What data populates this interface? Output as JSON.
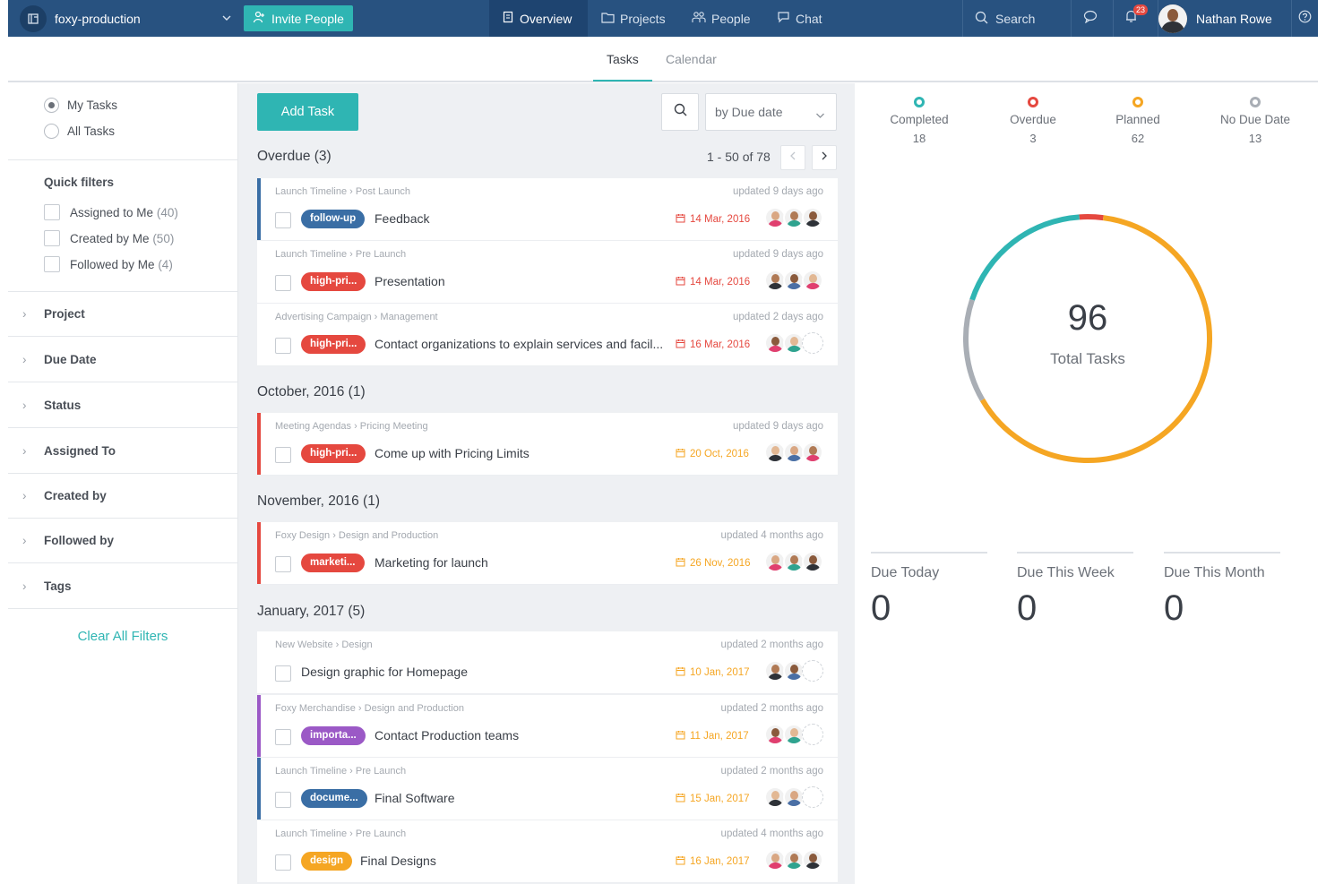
{
  "topbar": {
    "workspace": "foxy-production",
    "invite_label": "Invite People",
    "nav": [
      {
        "label": "Overview",
        "active": true
      },
      {
        "label": "Projects",
        "active": false
      },
      {
        "label": "People",
        "active": false
      },
      {
        "label": "Chat",
        "active": false
      }
    ],
    "search_label": "Search",
    "notification_count": "23",
    "user_name": "Nathan Rowe"
  },
  "subtabs": [
    {
      "label": "Tasks",
      "active": true
    },
    {
      "label": "Calendar",
      "active": false
    }
  ],
  "sidebar": {
    "scope": [
      {
        "label": "My Tasks",
        "selected": true
      },
      {
        "label": "All Tasks",
        "selected": false
      }
    ],
    "quick_filters_title": "Quick filters",
    "quick_filters": [
      {
        "label": "Assigned to Me",
        "count": "(40)"
      },
      {
        "label": "Created by Me",
        "count": "(50)"
      },
      {
        "label": "Followed by Me",
        "count": "(4)"
      }
    ],
    "filters": [
      "Project",
      "Due Date",
      "Status",
      "Assigned To",
      "Created by",
      "Followed by",
      "Tags"
    ],
    "clear_label": "Clear All Filters"
  },
  "tasks": {
    "add_label": "Add Task",
    "sort_label": "by Due date",
    "pager": "1 - 50 of 78",
    "groups": [
      {
        "title": "Overdue (3)"
      },
      {
        "title": "October, 2016 (1)"
      },
      {
        "title": "November, 2016 (1)"
      },
      {
        "title": "January, 2017 (5)"
      }
    ],
    "items": [
      {
        "project": "Launch Timeline",
        "list": "Post Launch",
        "updated": "updated 9 days ago",
        "tag": "follow-up",
        "tag_color": "#3a6ea5",
        "title": "Feedback",
        "due": "14 Mar, 2016",
        "due_color": "#e5483f",
        "stripe": "#3a6ea5"
      },
      {
        "project": "Launch Timeline",
        "list": "Pre Launch",
        "updated": "updated 9 days ago",
        "tag": "high-pri...",
        "tag_color": "#e5483f",
        "title": "Presentation",
        "due": "14 Mar, 2016",
        "due_color": "#e5483f",
        "stripe": ""
      },
      {
        "project": "Advertising Campaign",
        "list": "Management",
        "updated": "updated 2 days ago",
        "tag": "high-pri...",
        "tag_color": "#e5483f",
        "title": "Contact organizations to explain services and facil...",
        "due": "16 Mar, 2016",
        "due_color": "#e5483f",
        "stripe": ""
      },
      {
        "project": "Meeting Agendas",
        "list": "Pricing Meeting",
        "updated": "updated 9 days ago",
        "tag": "high-pri...",
        "tag_color": "#e5483f",
        "title": "Come up with Pricing Limits",
        "due": "20 Oct, 2016",
        "due_color": "#f5a623",
        "stripe": "#e5483f"
      },
      {
        "project": "Foxy Design",
        "list": "Design and Production",
        "updated": "updated 4 months ago",
        "tag": "marketi...",
        "tag_color": "#e5483f",
        "title": "Marketing for launch",
        "due": "26 Nov, 2016",
        "due_color": "#f5a623",
        "stripe": "#e5483f"
      },
      {
        "project": "New Website",
        "list": "Design",
        "updated": "updated 2 months ago",
        "tag": "",
        "tag_color": "",
        "title": "Design graphic for Homepage",
        "due": "10 Jan, 2017",
        "due_color": "#f5a623",
        "stripe": ""
      },
      {
        "project": "Foxy Merchandise",
        "list": "Design and Production",
        "updated": "updated 2 months ago",
        "tag": "importa...",
        "tag_color": "#9b59c6",
        "title": "Contact Production teams",
        "due": "11 Jan, 2017",
        "due_color": "#f5a623",
        "stripe": "#9b59c6"
      },
      {
        "project": "Launch Timeline",
        "list": "Pre Launch",
        "updated": "updated 2 months ago",
        "tag": "docume...",
        "tag_color": "#3a6ea5",
        "title": "Final Software",
        "due": "15 Jan, 2017",
        "due_color": "#f5a623",
        "stripe": "#3a6ea5"
      },
      {
        "project": "Launch Timeline",
        "list": "Pre Launch",
        "updated": "updated 4 months ago",
        "tag": "design",
        "tag_color": "#f5a623",
        "title": "Final Designs",
        "due": "16 Jan, 2017",
        "due_color": "#f5a623",
        "stripe": ""
      }
    ]
  },
  "stats": {
    "legend": [
      {
        "label": "Completed",
        "value": "18",
        "color": "#2fb5b3"
      },
      {
        "label": "Overdue",
        "value": "3",
        "color": "#e5483f"
      },
      {
        "label": "Planned",
        "value": "62",
        "color": "#f5a623"
      },
      {
        "label": "No Due Date",
        "value": "13",
        "color": "#a9aeb5"
      }
    ],
    "total": "96",
    "total_label": "Total Tasks",
    "due_blocks": [
      {
        "label": "Due Today",
        "value": "0"
      },
      {
        "label": "Due This Week",
        "value": "0"
      },
      {
        "label": "Due This Month",
        "value": "0"
      }
    ]
  }
}
